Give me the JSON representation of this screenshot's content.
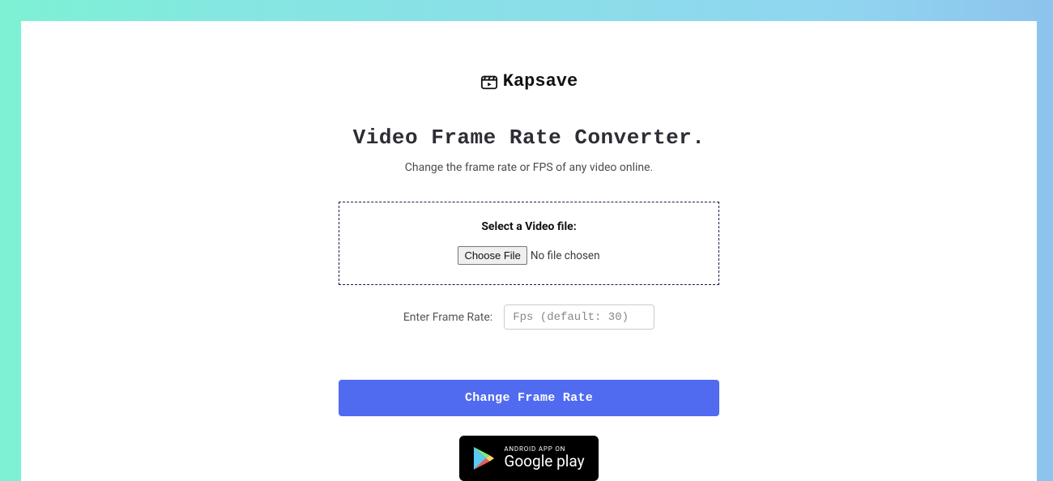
{
  "brand": {
    "name": "Kapsave"
  },
  "page": {
    "title": "Video Frame Rate Converter.",
    "subtitle": "Change the frame rate or FPS of any video online."
  },
  "dropzone": {
    "label": "Select a Video file:",
    "choose_button": "Choose File",
    "no_file_text": "No file chosen"
  },
  "fps": {
    "label": "Enter Frame Rate:",
    "placeholder": "Fps (default: 30)"
  },
  "cta": {
    "label": "Change Frame Rate"
  },
  "gplay": {
    "top": "ANDROID APP ON",
    "bottom": "Google play"
  }
}
